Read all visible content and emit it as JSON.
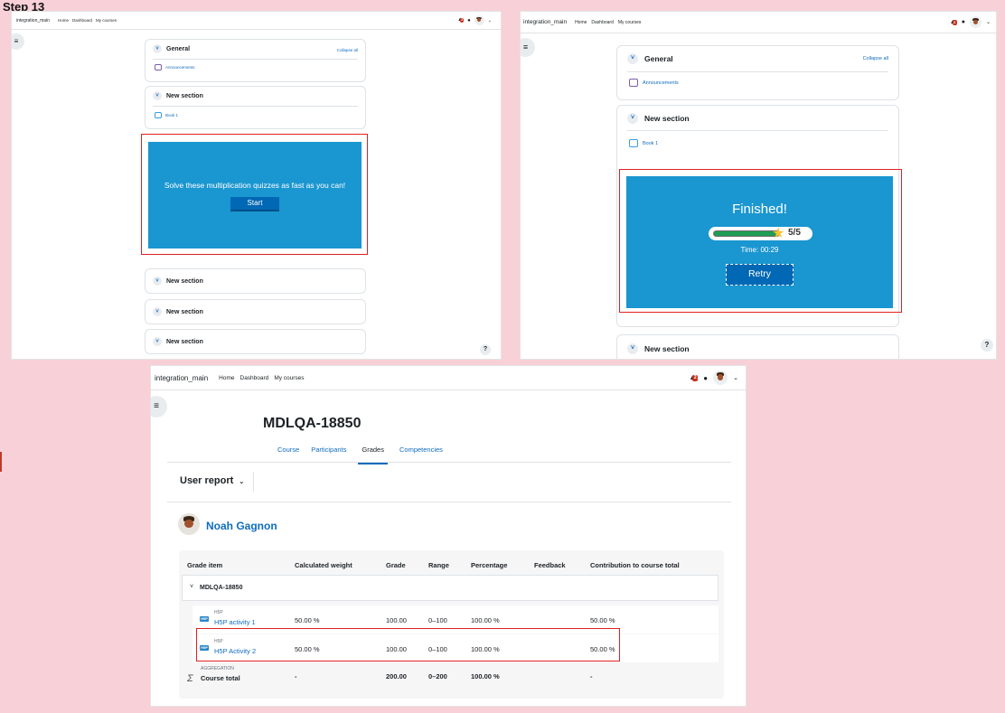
{
  "step_label": "Step 13",
  "nav": {
    "site": "integration_main",
    "links": [
      "Home",
      "Dashboard",
      "My courses"
    ],
    "notifications": "2"
  },
  "course_sections": {
    "general": "General",
    "collapse_all": "Collapse all",
    "announcements": "Announcements",
    "new_section": "New section",
    "book": "Book 1"
  },
  "h5p_start": {
    "text": "Solve these multiplication quizzes as fast as you can!",
    "button": "Start"
  },
  "h5p_finished": {
    "title": "Finished!",
    "score": "5/5",
    "time": "Time: 00:29",
    "button": "Retry",
    "progress_fraction": 1.0
  },
  "grades": {
    "course_title": "MDLQA-18850",
    "tabs": [
      "Course",
      "Participants",
      "Grades",
      "Competencies"
    ],
    "active_tab": "Grades",
    "report_title": "User report",
    "user_name": "Noah Gagnon",
    "columns": [
      "Grade item",
      "Calculated weight",
      "Grade",
      "Range",
      "Percentage",
      "Feedback",
      "Contribution to course total"
    ],
    "category": "MDLQA-18850",
    "rows": [
      {
        "type": "H5P",
        "name": "H5P activity 1",
        "weight": "50.00 %",
        "grade": "100.00",
        "range": "0–100",
        "percentage": "100.00 %",
        "feedback": "",
        "contribution": "50.00 %"
      },
      {
        "type": "H5P",
        "name": "H5P Activity 2",
        "weight": "50.00 %",
        "grade": "100.00",
        "range": "0–100",
        "percentage": "100.00 %",
        "feedback": "",
        "contribution": "50.00 %"
      }
    ],
    "total": {
      "type": "AGGREGATION",
      "name": "Course total",
      "weight": "-",
      "grade": "200.00",
      "range": "0–200",
      "percentage": "100.00 %",
      "contribution": "-"
    }
  },
  "icons": {
    "menu": "hamburger-icon",
    "help": "question-icon",
    "bell": "bell-icon",
    "chat": "chat-icon"
  }
}
